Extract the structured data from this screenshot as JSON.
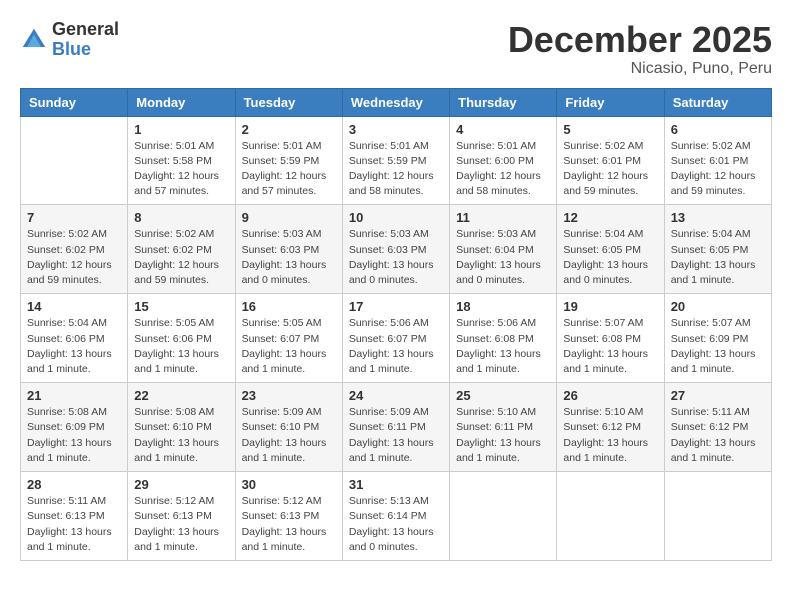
{
  "logo": {
    "text_general": "General",
    "text_blue": "Blue"
  },
  "title": {
    "month_year": "December 2025",
    "location": "Nicasio, Puno, Peru"
  },
  "days_of_week": [
    "Sunday",
    "Monday",
    "Tuesday",
    "Wednesday",
    "Thursday",
    "Friday",
    "Saturday"
  ],
  "weeks": [
    [
      {
        "day": "",
        "info": ""
      },
      {
        "day": "1",
        "info": "Sunrise: 5:01 AM\nSunset: 5:58 PM\nDaylight: 12 hours\nand 57 minutes."
      },
      {
        "day": "2",
        "info": "Sunrise: 5:01 AM\nSunset: 5:59 PM\nDaylight: 12 hours\nand 57 minutes."
      },
      {
        "day": "3",
        "info": "Sunrise: 5:01 AM\nSunset: 5:59 PM\nDaylight: 12 hours\nand 58 minutes."
      },
      {
        "day": "4",
        "info": "Sunrise: 5:01 AM\nSunset: 6:00 PM\nDaylight: 12 hours\nand 58 minutes."
      },
      {
        "day": "5",
        "info": "Sunrise: 5:02 AM\nSunset: 6:01 PM\nDaylight: 12 hours\nand 59 minutes."
      },
      {
        "day": "6",
        "info": "Sunrise: 5:02 AM\nSunset: 6:01 PM\nDaylight: 12 hours\nand 59 minutes."
      }
    ],
    [
      {
        "day": "7",
        "info": "Sunrise: 5:02 AM\nSunset: 6:02 PM\nDaylight: 12 hours\nand 59 minutes."
      },
      {
        "day": "8",
        "info": "Sunrise: 5:02 AM\nSunset: 6:02 PM\nDaylight: 12 hours\nand 59 minutes."
      },
      {
        "day": "9",
        "info": "Sunrise: 5:03 AM\nSunset: 6:03 PM\nDaylight: 13 hours\nand 0 minutes."
      },
      {
        "day": "10",
        "info": "Sunrise: 5:03 AM\nSunset: 6:03 PM\nDaylight: 13 hours\nand 0 minutes."
      },
      {
        "day": "11",
        "info": "Sunrise: 5:03 AM\nSunset: 6:04 PM\nDaylight: 13 hours\nand 0 minutes."
      },
      {
        "day": "12",
        "info": "Sunrise: 5:04 AM\nSunset: 6:05 PM\nDaylight: 13 hours\nand 0 minutes."
      },
      {
        "day": "13",
        "info": "Sunrise: 5:04 AM\nSunset: 6:05 PM\nDaylight: 13 hours\nand 1 minute."
      }
    ],
    [
      {
        "day": "14",
        "info": "Sunrise: 5:04 AM\nSunset: 6:06 PM\nDaylight: 13 hours\nand 1 minute."
      },
      {
        "day": "15",
        "info": "Sunrise: 5:05 AM\nSunset: 6:06 PM\nDaylight: 13 hours\nand 1 minute."
      },
      {
        "day": "16",
        "info": "Sunrise: 5:05 AM\nSunset: 6:07 PM\nDaylight: 13 hours\nand 1 minute."
      },
      {
        "day": "17",
        "info": "Sunrise: 5:06 AM\nSunset: 6:07 PM\nDaylight: 13 hours\nand 1 minute."
      },
      {
        "day": "18",
        "info": "Sunrise: 5:06 AM\nSunset: 6:08 PM\nDaylight: 13 hours\nand 1 minute."
      },
      {
        "day": "19",
        "info": "Sunrise: 5:07 AM\nSunset: 6:08 PM\nDaylight: 13 hours\nand 1 minute."
      },
      {
        "day": "20",
        "info": "Sunrise: 5:07 AM\nSunset: 6:09 PM\nDaylight: 13 hours\nand 1 minute."
      }
    ],
    [
      {
        "day": "21",
        "info": "Sunrise: 5:08 AM\nSunset: 6:09 PM\nDaylight: 13 hours\nand 1 minute."
      },
      {
        "day": "22",
        "info": "Sunrise: 5:08 AM\nSunset: 6:10 PM\nDaylight: 13 hours\nand 1 minute."
      },
      {
        "day": "23",
        "info": "Sunrise: 5:09 AM\nSunset: 6:10 PM\nDaylight: 13 hours\nand 1 minute."
      },
      {
        "day": "24",
        "info": "Sunrise: 5:09 AM\nSunset: 6:11 PM\nDaylight: 13 hours\nand 1 minute."
      },
      {
        "day": "25",
        "info": "Sunrise: 5:10 AM\nSunset: 6:11 PM\nDaylight: 13 hours\nand 1 minute."
      },
      {
        "day": "26",
        "info": "Sunrise: 5:10 AM\nSunset: 6:12 PM\nDaylight: 13 hours\nand 1 minute."
      },
      {
        "day": "27",
        "info": "Sunrise: 5:11 AM\nSunset: 6:12 PM\nDaylight: 13 hours\nand 1 minute."
      }
    ],
    [
      {
        "day": "28",
        "info": "Sunrise: 5:11 AM\nSunset: 6:13 PM\nDaylight: 13 hours\nand 1 minute."
      },
      {
        "day": "29",
        "info": "Sunrise: 5:12 AM\nSunset: 6:13 PM\nDaylight: 13 hours\nand 1 minute."
      },
      {
        "day": "30",
        "info": "Sunrise: 5:12 AM\nSunset: 6:13 PM\nDaylight: 13 hours\nand 1 minute."
      },
      {
        "day": "31",
        "info": "Sunrise: 5:13 AM\nSunset: 6:14 PM\nDaylight: 13 hours\nand 0 minutes."
      },
      {
        "day": "",
        "info": ""
      },
      {
        "day": "",
        "info": ""
      },
      {
        "day": "",
        "info": ""
      }
    ]
  ]
}
